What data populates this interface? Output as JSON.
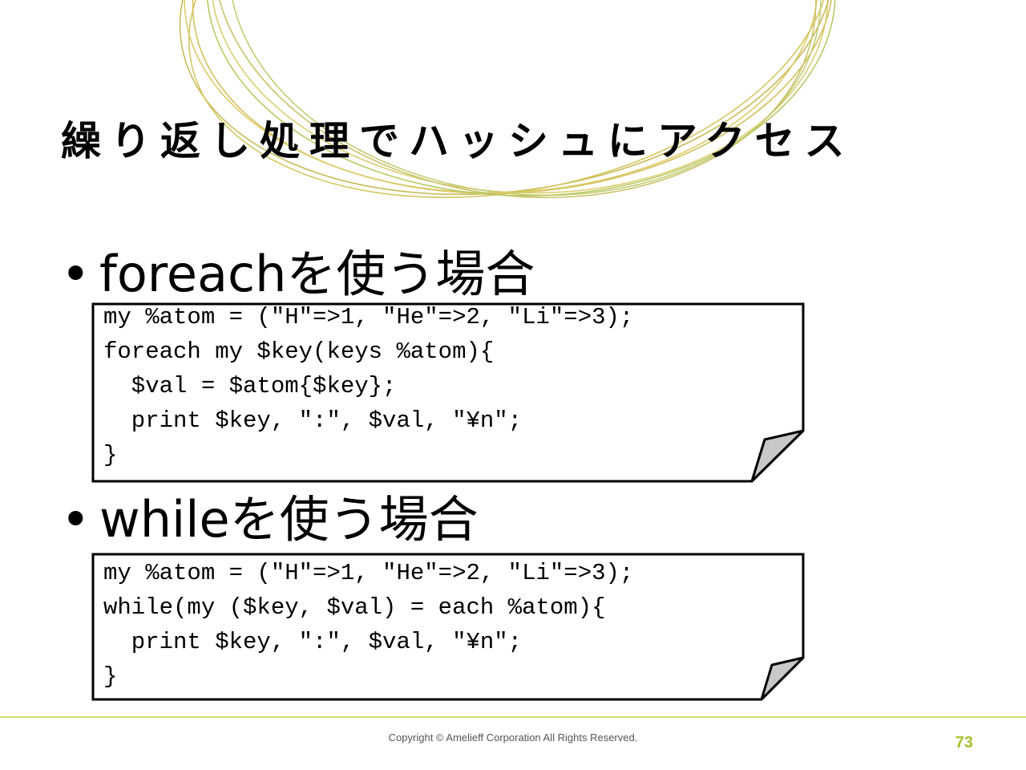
{
  "slide": {
    "title": "繰り返し処理でハッシュにアクセス",
    "colors": {
      "ring": "#c9b640",
      "accent": "#a8bf2e",
      "footer_line": "#d4dc6a",
      "fold": "#c8c8c8"
    }
  },
  "sections": [
    {
      "bullet": "•",
      "heading": "foreachを使う場合",
      "code": [
        "my %atom = (\"H\"=>1, \"He\"=>2, \"Li\"=>3);",
        "foreach my $key(keys %atom){",
        "  $val = $atom{$key};",
        "  print $key, \":\", $val, \"¥n\";",
        "}"
      ]
    },
    {
      "bullet": "•",
      "heading": "whileを使う場合",
      "code": [
        "my %atom = (\"H\"=>1, \"He\"=>2, \"Li\"=>3);",
        "while(my ($key, $val) = each %atom){",
        "  print $key, \":\", $val, \"¥n\";",
        "}"
      ]
    }
  ],
  "footer": {
    "copyright": "Copyright © Amelieff Corporation All Rights Reserved.",
    "page_number": "73"
  }
}
